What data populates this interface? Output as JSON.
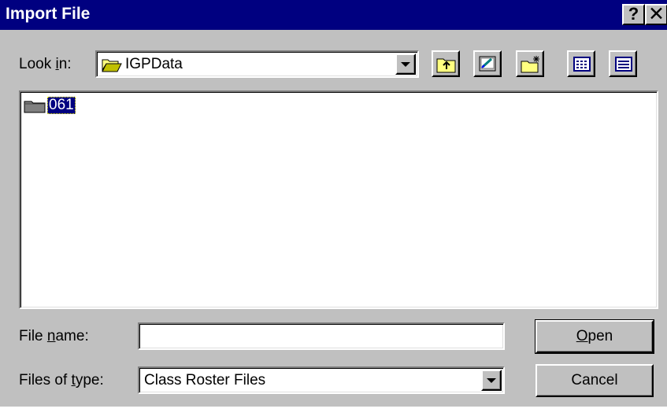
{
  "window": {
    "title": "Import File",
    "help_glyph": "?",
    "close_glyph": "✕"
  },
  "lookin": {
    "label_pre": "Look ",
    "label_accel": "i",
    "label_post": "n:",
    "value": "IGPData",
    "folder_icon": "open-folder-icon"
  },
  "toolbar": {
    "buttons": [
      {
        "name": "up-one-level-button",
        "icon": "up-folder-icon"
      },
      {
        "name": "go-to-desktop-button",
        "icon": "desktop-icon"
      },
      {
        "name": "create-new-folder-button",
        "icon": "new-folder-icon"
      },
      {
        "name": "list-view-button",
        "icon": "list-view-icon"
      },
      {
        "name": "details-view-button",
        "icon": "details-view-icon"
      }
    ]
  },
  "file_list": {
    "items": [
      {
        "label": "061",
        "icon": "folder-icon",
        "selected": true
      }
    ]
  },
  "filename": {
    "label_pre": "File ",
    "label_accel": "n",
    "label_post": "ame:",
    "value": ""
  },
  "filetype": {
    "label_pre": "Files of ",
    "label_accel": "t",
    "label_post": "ype:",
    "value": "Class Roster Files"
  },
  "buttons": {
    "open_accel": "O",
    "open_rest": "pen",
    "cancel": "Cancel"
  },
  "colors": {
    "face": "#c0c0c0",
    "titlebar": "#000080",
    "selection": "#000080",
    "window_bg": "#ffffff"
  }
}
